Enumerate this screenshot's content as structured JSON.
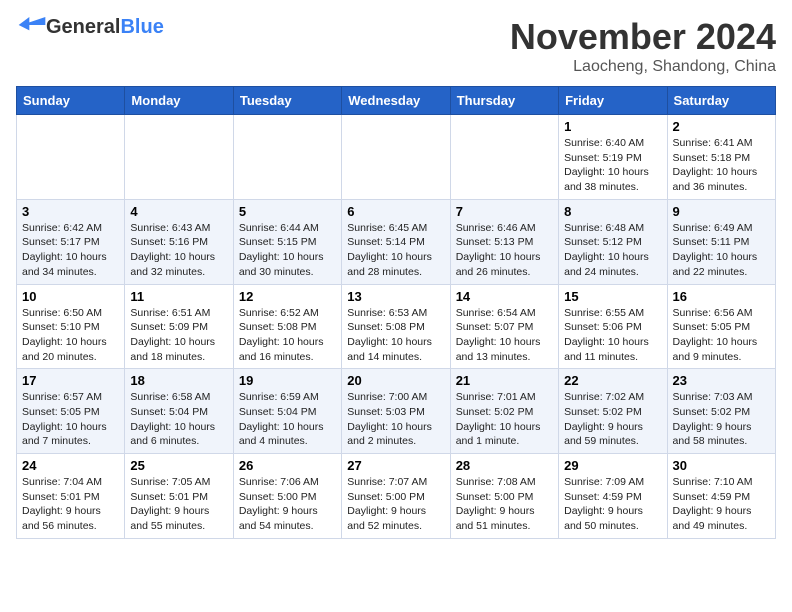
{
  "header": {
    "logo_general": "General",
    "logo_blue": "Blue",
    "month_title": "November 2024",
    "location": "Laocheng, Shandong, China"
  },
  "calendar": {
    "days_of_week": [
      "Sunday",
      "Monday",
      "Tuesday",
      "Wednesday",
      "Thursday",
      "Friday",
      "Saturday"
    ],
    "weeks": [
      [
        {
          "day": "",
          "info": ""
        },
        {
          "day": "",
          "info": ""
        },
        {
          "day": "",
          "info": ""
        },
        {
          "day": "",
          "info": ""
        },
        {
          "day": "",
          "info": ""
        },
        {
          "day": "1",
          "info": "Sunrise: 6:40 AM\nSunset: 5:19 PM\nDaylight: 10 hours and 38 minutes."
        },
        {
          "day": "2",
          "info": "Sunrise: 6:41 AM\nSunset: 5:18 PM\nDaylight: 10 hours and 36 minutes."
        }
      ],
      [
        {
          "day": "3",
          "info": "Sunrise: 6:42 AM\nSunset: 5:17 PM\nDaylight: 10 hours and 34 minutes."
        },
        {
          "day": "4",
          "info": "Sunrise: 6:43 AM\nSunset: 5:16 PM\nDaylight: 10 hours and 32 minutes."
        },
        {
          "day": "5",
          "info": "Sunrise: 6:44 AM\nSunset: 5:15 PM\nDaylight: 10 hours and 30 minutes."
        },
        {
          "day": "6",
          "info": "Sunrise: 6:45 AM\nSunset: 5:14 PM\nDaylight: 10 hours and 28 minutes."
        },
        {
          "day": "7",
          "info": "Sunrise: 6:46 AM\nSunset: 5:13 PM\nDaylight: 10 hours and 26 minutes."
        },
        {
          "day": "8",
          "info": "Sunrise: 6:48 AM\nSunset: 5:12 PM\nDaylight: 10 hours and 24 minutes."
        },
        {
          "day": "9",
          "info": "Sunrise: 6:49 AM\nSunset: 5:11 PM\nDaylight: 10 hours and 22 minutes."
        }
      ],
      [
        {
          "day": "10",
          "info": "Sunrise: 6:50 AM\nSunset: 5:10 PM\nDaylight: 10 hours and 20 minutes."
        },
        {
          "day": "11",
          "info": "Sunrise: 6:51 AM\nSunset: 5:09 PM\nDaylight: 10 hours and 18 minutes."
        },
        {
          "day": "12",
          "info": "Sunrise: 6:52 AM\nSunset: 5:08 PM\nDaylight: 10 hours and 16 minutes."
        },
        {
          "day": "13",
          "info": "Sunrise: 6:53 AM\nSunset: 5:08 PM\nDaylight: 10 hours and 14 minutes."
        },
        {
          "day": "14",
          "info": "Sunrise: 6:54 AM\nSunset: 5:07 PM\nDaylight: 10 hours and 13 minutes."
        },
        {
          "day": "15",
          "info": "Sunrise: 6:55 AM\nSunset: 5:06 PM\nDaylight: 10 hours and 11 minutes."
        },
        {
          "day": "16",
          "info": "Sunrise: 6:56 AM\nSunset: 5:05 PM\nDaylight: 10 hours and 9 minutes."
        }
      ],
      [
        {
          "day": "17",
          "info": "Sunrise: 6:57 AM\nSunset: 5:05 PM\nDaylight: 10 hours and 7 minutes."
        },
        {
          "day": "18",
          "info": "Sunrise: 6:58 AM\nSunset: 5:04 PM\nDaylight: 10 hours and 6 minutes."
        },
        {
          "day": "19",
          "info": "Sunrise: 6:59 AM\nSunset: 5:04 PM\nDaylight: 10 hours and 4 minutes."
        },
        {
          "day": "20",
          "info": "Sunrise: 7:00 AM\nSunset: 5:03 PM\nDaylight: 10 hours and 2 minutes."
        },
        {
          "day": "21",
          "info": "Sunrise: 7:01 AM\nSunset: 5:02 PM\nDaylight: 10 hours and 1 minute."
        },
        {
          "day": "22",
          "info": "Sunrise: 7:02 AM\nSunset: 5:02 PM\nDaylight: 9 hours and 59 minutes."
        },
        {
          "day": "23",
          "info": "Sunrise: 7:03 AM\nSunset: 5:02 PM\nDaylight: 9 hours and 58 minutes."
        }
      ],
      [
        {
          "day": "24",
          "info": "Sunrise: 7:04 AM\nSunset: 5:01 PM\nDaylight: 9 hours and 56 minutes."
        },
        {
          "day": "25",
          "info": "Sunrise: 7:05 AM\nSunset: 5:01 PM\nDaylight: 9 hours and 55 minutes."
        },
        {
          "day": "26",
          "info": "Sunrise: 7:06 AM\nSunset: 5:00 PM\nDaylight: 9 hours and 54 minutes."
        },
        {
          "day": "27",
          "info": "Sunrise: 7:07 AM\nSunset: 5:00 PM\nDaylight: 9 hours and 52 minutes."
        },
        {
          "day": "28",
          "info": "Sunrise: 7:08 AM\nSunset: 5:00 PM\nDaylight: 9 hours and 51 minutes."
        },
        {
          "day": "29",
          "info": "Sunrise: 7:09 AM\nSunset: 4:59 PM\nDaylight: 9 hours and 50 minutes."
        },
        {
          "day": "30",
          "info": "Sunrise: 7:10 AM\nSunset: 4:59 PM\nDaylight: 9 hours and 49 minutes."
        }
      ]
    ]
  }
}
